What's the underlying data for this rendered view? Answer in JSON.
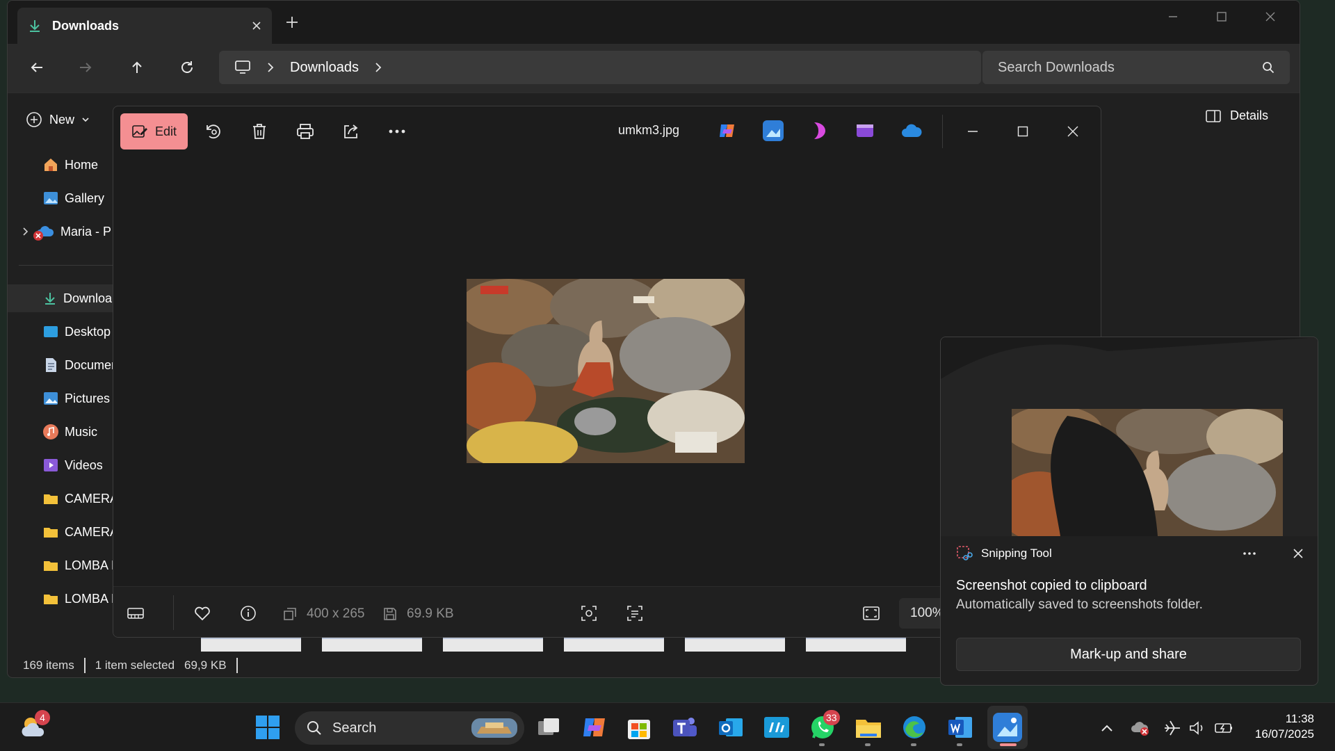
{
  "explorer": {
    "tab_title": "Downloads",
    "breadcrumb": "Downloads",
    "search_placeholder": "Search Downloads",
    "toolbar": {
      "new_label": "New",
      "details_label": "Details"
    },
    "sidebar": [
      {
        "label": "Home",
        "icon": "home-icon"
      },
      {
        "label": "Gallery",
        "icon": "gallery-icon"
      },
      {
        "label": "Maria - P",
        "icon": "onedrive-icon"
      },
      {
        "label": "Downloa",
        "icon": "download-icon"
      },
      {
        "label": "Desktop",
        "icon": "desktop-icon"
      },
      {
        "label": "Documer",
        "icon": "documents-icon"
      },
      {
        "label": "Pictures",
        "icon": "pictures-icon"
      },
      {
        "label": "Music",
        "icon": "music-icon"
      },
      {
        "label": "Videos",
        "icon": "videos-icon"
      },
      {
        "label": "CAMERA",
        "icon": "folder-icon"
      },
      {
        "label": "CAMERA",
        "icon": "folder-icon"
      },
      {
        "label": "LOMBA F",
        "icon": "folder-icon"
      },
      {
        "label": "LOMBA E",
        "icon": "folder-icon"
      }
    ],
    "status": {
      "items": "169 items",
      "selected": "1 item selected",
      "size": "69,9 KB"
    }
  },
  "photos": {
    "edit_label": "Edit",
    "filename": "umkm3.jpg",
    "dimensions": "400 x 265",
    "filesize": "69.9 KB",
    "zoom": "100%"
  },
  "snipping": {
    "app_name": "Snipping Tool",
    "title": "Screenshot copied to clipboard",
    "subtitle": "Automatically saved to screenshots folder.",
    "button": "Mark-up and share"
  },
  "taskbar": {
    "search_label": "Search",
    "weather_badge": "4",
    "whatsapp_badge": "33",
    "time": "11:38",
    "date": "16/07/2025"
  },
  "colors": {
    "accent_edit": "#f48f92",
    "download_green": "#4cc2a0",
    "folder_yellow": "#f3c13a"
  }
}
